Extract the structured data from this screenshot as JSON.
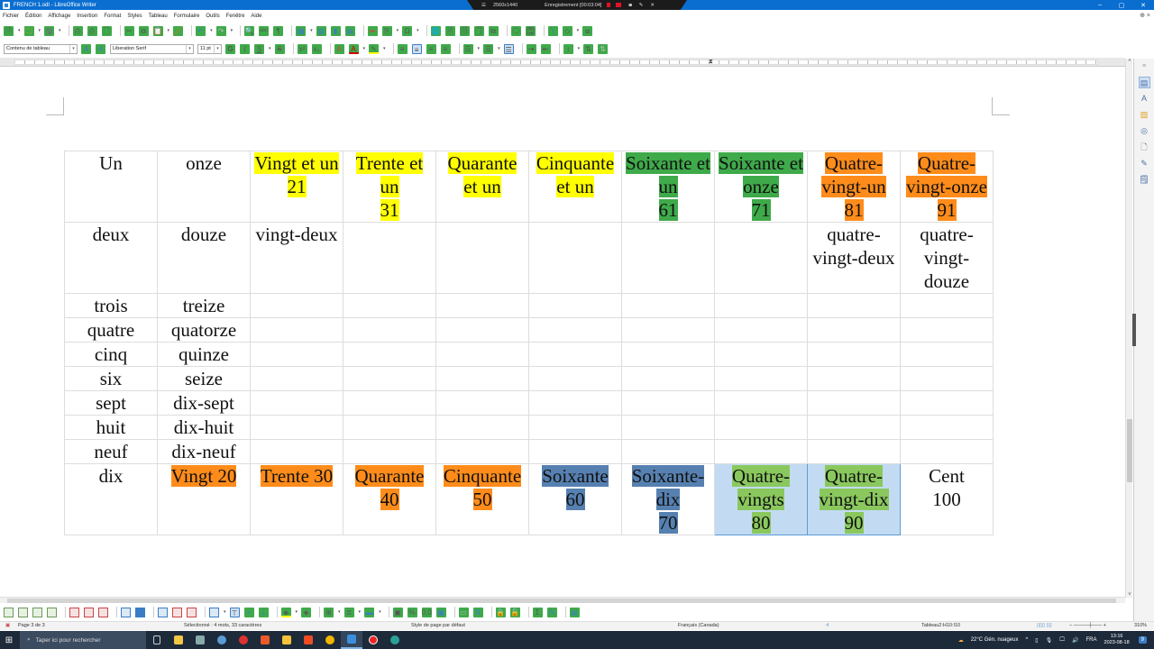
{
  "window": {
    "title": "FRENCH 1.odt - LibreOffice Writer",
    "controls": [
      "–",
      "▢",
      "✕"
    ]
  },
  "recorder": {
    "resolution": "2560x1440",
    "status": "Enregistrement [00:03:04]"
  },
  "menu": [
    "Fichier",
    "Édition",
    "Affichage",
    "Insertion",
    "Format",
    "Styles",
    "Tableau",
    "Formulaire",
    "Outils",
    "Fenêtre",
    "Aide"
  ],
  "formatting": {
    "paragraph_style": "Contenu de tableau",
    "font_name": "Liberation Serif",
    "font_size": "11 pt",
    "bold": "G",
    "italic": "I",
    "underline": "S",
    "strike": "S"
  },
  "table": {
    "highlight_colors": {
      "yellow": "#ffff00",
      "green": "#3faa4a",
      "orange": "#ff8c1a",
      "blue": "#5680b0",
      "light_green": "#8ac85e",
      "selection": "#c3dbf2"
    },
    "row1": [
      {
        "text": "Un",
        "hl": ""
      },
      {
        "text": "onze",
        "hl": ""
      },
      {
        "text": "Vingt et un\n21",
        "hl": "yellow"
      },
      {
        "text": "Trente et\nun\n31",
        "hl": "yellow"
      },
      {
        "text": "Quarante\net un",
        "hl": "yellow"
      },
      {
        "text": "Cinquante\net un",
        "hl": "yellow"
      },
      {
        "text": "Soixante et\nun\n61",
        "hl": "green"
      },
      {
        "text": "Soixante et\nonze\n71",
        "hl": "green"
      },
      {
        "text": "Quatre-\nvingt-un\n81",
        "hl": "orange"
      },
      {
        "text": "Quatre-\nvingt-onze\n91",
        "hl": "orange"
      }
    ],
    "row2": [
      {
        "text": "deux"
      },
      {
        "text": "douze"
      },
      {
        "text": "vingt-deux"
      },
      {
        "text": ""
      },
      {
        "text": ""
      },
      {
        "text": ""
      },
      {
        "text": ""
      },
      {
        "text": ""
      },
      {
        "text": "quatre-\nvingt-deux"
      },
      {
        "text": "quatre-\nvingt-\ndouze"
      }
    ],
    "simple_rows": [
      [
        "trois",
        "treize"
      ],
      [
        "quatre",
        "quatorze"
      ],
      [
        "cinq",
        "quinze"
      ],
      [
        "six",
        "seize"
      ],
      [
        "sept",
        "dix-sept"
      ],
      [
        "huit",
        "dix-huit"
      ],
      [
        "neuf",
        "dix-neuf"
      ]
    ],
    "row10": [
      {
        "text": "dix",
        "hl": ""
      },
      {
        "text": "Vingt   20",
        "hl": "orange"
      },
      {
        "text": "Trente 30",
        "hl": "orange"
      },
      {
        "text": "Quarante\n40",
        "hl": "orange"
      },
      {
        "text": "Cinquante\n50",
        "hl": "orange"
      },
      {
        "text": "Soixante\n60",
        "hl": "blue"
      },
      {
        "text": "Soixante-\ndix\n70",
        "hl": "blue"
      },
      {
        "text": "Quatre-\nvingts\n80",
        "hl": "light_green",
        "selected": true
      },
      {
        "text": "Quatre-\nvingt-dix\n90",
        "hl": "light_green",
        "selected": true
      },
      {
        "text": "Cent\n100",
        "hl": ""
      }
    ]
  },
  "status": {
    "page": "Page 3 de 3",
    "selection": "Sélectionné : 4 mots, 33 caractères",
    "page_style": "Style de page par défaut",
    "language": "Français (Canada)",
    "table_cell": "Tableau2:H10:I10",
    "zoom": "310%"
  },
  "taskbar": {
    "search_placeholder": "Taper ici pour rechercher",
    "weather": "22°C  Gén. nuageux",
    "lang": "FRA",
    "time": "13:16",
    "date": "2023-08-18",
    "notifications": "9"
  }
}
